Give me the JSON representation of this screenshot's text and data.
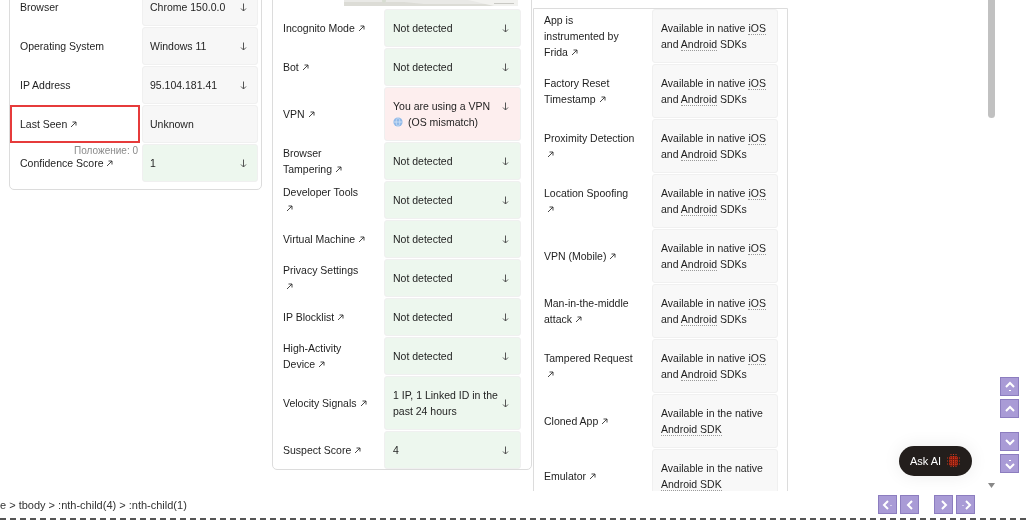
{
  "identity_card": {
    "rows": [
      {
        "label": "Browser",
        "linked": false,
        "highlighted": false,
        "value": "Chrome 150.0.0",
        "expandable": true,
        "color": "#f7f7f7"
      },
      {
        "label": "Operating System",
        "linked": false,
        "highlighted": false,
        "value": "Windows 11",
        "expandable": true,
        "color": "#f7f7f7"
      },
      {
        "label": "IP Address",
        "linked": false,
        "highlighted": false,
        "value": "95.104.181.41",
        "expandable": true,
        "color": "#f7f7f7"
      },
      {
        "label": "Last Seen",
        "linked": true,
        "highlighted": true,
        "value": "Unknown",
        "expandable": false,
        "color": "#f7f7f7"
      },
      {
        "label": "Confidence Score",
        "linked": true,
        "highlighted": false,
        "value": "1",
        "expandable": true,
        "color": "#edf7ee"
      }
    ],
    "highlight_tooltip": "Положение: 0"
  },
  "signals_card": {
    "rows": [
      {
        "label": "Incognito Mode",
        "linked": true,
        "value": "Not detected",
        "expandable": true,
        "color": "#edf7ee"
      },
      {
        "label": "Bot",
        "linked": true,
        "value": "Not detected",
        "expandable": true,
        "color": "#edf7ee"
      },
      {
        "label": "VPN",
        "linked": true,
        "value": "You are using a VPN",
        "detail": "(OS mismatch)",
        "expandable": true,
        "color": "#fdeeee"
      },
      {
        "label": "Browser Tampering",
        "linked": true,
        "value": "Not detected",
        "expandable": true,
        "color": "#edf7ee"
      },
      {
        "label": "Developer Tools",
        "linked": true,
        "value": "Not detected",
        "expandable": true,
        "color": "#edf7ee"
      },
      {
        "label": "Virtual Machine",
        "linked": true,
        "value": "Not detected",
        "expandable": true,
        "color": "#edf7ee"
      },
      {
        "label": "Privacy Settings",
        "linked": true,
        "value": "Not detected",
        "expandable": true,
        "color": "#edf7ee"
      },
      {
        "label": "IP Blocklist",
        "linked": true,
        "value": "Not detected",
        "expandable": true,
        "color": "#edf7ee"
      },
      {
        "label": "High-Activity Device",
        "linked": true,
        "value": "Not detected",
        "expandable": true,
        "color": "#edf7ee"
      },
      {
        "label": "Velocity Signals",
        "linked": true,
        "value": "1 IP, 1 Linked ID in the past 24 hours",
        "expandable": true,
        "color": "#edf7ee"
      },
      {
        "label": "Suspect Score",
        "linked": true,
        "value": "4",
        "expandable": true,
        "color": "#edf7ee"
      }
    ]
  },
  "mobile_card": {
    "rows": [
      {
        "label": "App is instrumented by Frida",
        "linked": true,
        "segments": [
          {
            "text": "Available in native ",
            "term": false
          },
          {
            "text": "iOS",
            "term": true
          },
          {
            "text": " and ",
            "term": false
          },
          {
            "text": "Android",
            "term": true
          },
          {
            "text": " SDKs",
            "term": false
          }
        ]
      },
      {
        "label": "Factory Reset Timestamp",
        "linked": true,
        "segments": [
          {
            "text": "Available in native ",
            "term": false
          },
          {
            "text": "iOS",
            "term": true
          },
          {
            "text": " and ",
            "term": false
          },
          {
            "text": "Android",
            "term": true
          },
          {
            "text": " SDKs",
            "term": false
          }
        ]
      },
      {
        "label": "Proximity Detection",
        "linked": true,
        "segments": [
          {
            "text": "Available in native ",
            "term": false
          },
          {
            "text": "iOS",
            "term": true
          },
          {
            "text": " and ",
            "term": false
          },
          {
            "text": "Android",
            "term": true
          },
          {
            "text": " SDKs",
            "term": false
          }
        ]
      },
      {
        "label": "Location Spoofing",
        "linked": true,
        "segments": [
          {
            "text": "Available in native ",
            "term": false
          },
          {
            "text": "iOS",
            "term": true
          },
          {
            "text": " and ",
            "term": false
          },
          {
            "text": "Android",
            "term": true
          },
          {
            "text": " SDKs",
            "term": false
          }
        ]
      },
      {
        "label": "VPN (Mobile)",
        "linked": true,
        "segments": [
          {
            "text": "Available in native ",
            "term": false
          },
          {
            "text": "iOS",
            "term": true
          },
          {
            "text": " and ",
            "term": false
          },
          {
            "text": "Android",
            "term": true
          },
          {
            "text": " SDKs",
            "term": false
          }
        ]
      },
      {
        "label": "Man-in-the-middle attack",
        "linked": true,
        "segments": [
          {
            "text": "Available in native ",
            "term": false
          },
          {
            "text": "iOS",
            "term": true
          },
          {
            "text": " and ",
            "term": false
          },
          {
            "text": "Android",
            "term": true
          },
          {
            "text": " SDKs",
            "term": false
          }
        ]
      },
      {
        "label": "Tampered Request",
        "linked": true,
        "segments": [
          {
            "text": "Available in native ",
            "term": false
          },
          {
            "text": "iOS",
            "term": true
          },
          {
            "text": " and ",
            "term": false
          },
          {
            "text": "Android",
            "term": true
          },
          {
            "text": " SDKs",
            "term": false
          }
        ]
      },
      {
        "label": "Cloned App",
        "linked": true,
        "segments": [
          {
            "text": "Available in the native ",
            "term": false
          },
          {
            "text": "Android SDK",
            "term": true
          }
        ]
      },
      {
        "label": "Emulator",
        "linked": true,
        "segments": [
          {
            "text": "Available in the native ",
            "term": false
          },
          {
            "text": "Android SDK",
            "term": true
          }
        ]
      }
    ]
  },
  "ask_ai": {
    "label": "Ask AI"
  },
  "breadcrumb": "e > tbody > :nth-child(4) > :nth-child(1)"
}
